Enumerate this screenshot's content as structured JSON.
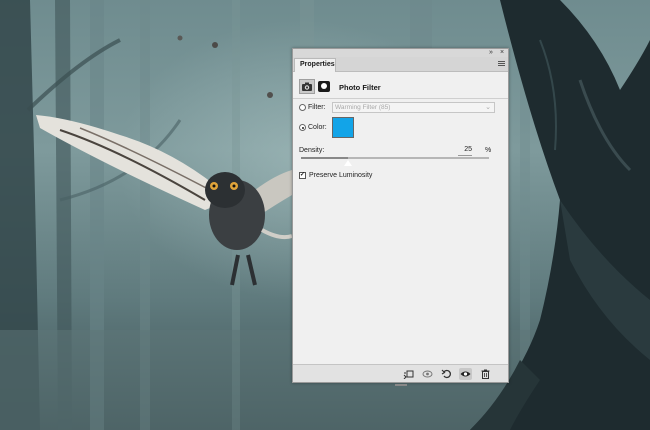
{
  "panel": {
    "tab_label": "Properties",
    "collapse_icon": "double-chevron-icon",
    "close_icon": "close-icon",
    "menu_icon": "panel-menu-icon",
    "adjustment_title": "Photo Filter",
    "filter": {
      "label": "Filter:",
      "selected": false,
      "value": "Warming Filter (85)",
      "enabled": false
    },
    "color": {
      "label": "Color:",
      "selected": true,
      "swatch": "#12a4e8"
    },
    "density": {
      "label": "Density:",
      "value": "25",
      "unit": "%",
      "fraction": 0.25
    },
    "preserve_luminosity": {
      "label": "Preserve Luminosity",
      "checked": true
    },
    "footer_buttons": [
      "clip-to-layer-icon",
      "view-previous-state-icon",
      "reset-icon",
      "visibility-eye-icon",
      "trash-icon"
    ]
  },
  "colors": {
    "panel_bg": "#f0f0f0",
    "accent_swatch": "#12a4e8"
  }
}
